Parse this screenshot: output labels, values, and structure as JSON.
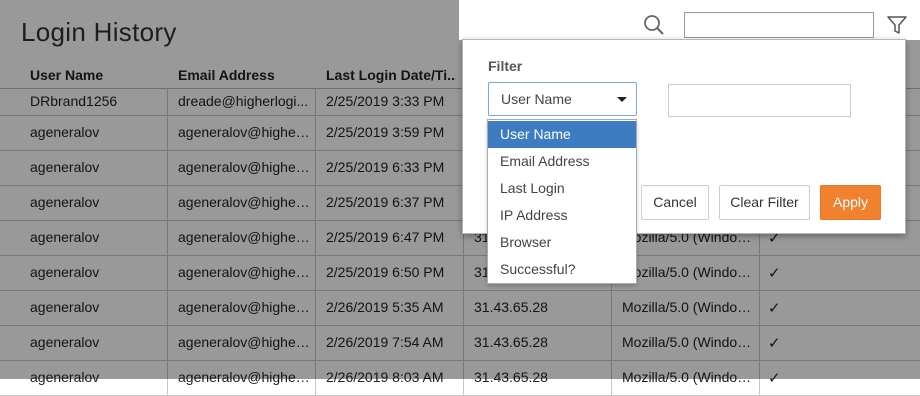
{
  "page": {
    "title": "Login History"
  },
  "table": {
    "headers": [
      "User Name",
      "Email Address",
      "Last Login Date/Ti..."
    ],
    "rows": [
      {
        "user": "DRbrand1256",
        "email": "dreade@higherlogi...",
        "date": "2/25/2019 3:33 PM",
        "ip": "",
        "browser": "",
        "ok": ""
      },
      {
        "user": "ageneralov",
        "email": "ageneralov@higherl...",
        "date": "2/25/2019 3:59 PM",
        "ip": "",
        "browser": "",
        "ok": ""
      },
      {
        "user": "ageneralov",
        "email": "ageneralov@higherl...",
        "date": "2/25/2019 6:33 PM",
        "ip": "",
        "browser": "",
        "ok": ""
      },
      {
        "user": "ageneralov",
        "email": "ageneralov@higherl...",
        "date": "2/25/2019 6:37 PM",
        "ip": "",
        "browser": "",
        "ok": ""
      },
      {
        "user": "ageneralov",
        "email": "ageneralov@higherl...",
        "date": "2/25/2019 6:47 PM",
        "ip": "31.",
        "browser": "Mozilla/5.0 (Window...",
        "ok": "✓"
      },
      {
        "user": "ageneralov",
        "email": "ageneralov@higherl...",
        "date": "2/25/2019 6:50 PM",
        "ip": "31.",
        "browser": "Mozilla/5.0 (Window...",
        "ok": "✓"
      },
      {
        "user": "ageneralov",
        "email": "ageneralov@higherl...",
        "date": "2/26/2019 5:35 AM",
        "ip": "31.43.65.28",
        "browser": "Mozilla/5.0 (Window...",
        "ok": "✓"
      },
      {
        "user": "ageneralov",
        "email": "ageneralov@higherl...",
        "date": "2/26/2019 7:54 AM",
        "ip": "31.43.65.28",
        "browser": "Mozilla/5.0 (Window...",
        "ok": "✓"
      },
      {
        "user": "ageneralov",
        "email": "ageneralov@higherl...",
        "date": "2/26/2019 8:03 AM",
        "ip": "31.43.65.28",
        "browser": "Mozilla/5.0 (Window...",
        "ok": "✓"
      }
    ]
  },
  "toolbar": {
    "search_value": "",
    "search_icon": "search-icon",
    "filter_icon": "filter-icon"
  },
  "filter": {
    "label": "Filter",
    "selected_field": "User Name",
    "value": "",
    "options": [
      "User Name",
      "Email Address",
      "Last Login",
      "IP Address",
      "Browser",
      "Successful?"
    ],
    "cancel_label": "Cancel",
    "clear_label": "Clear Filter",
    "apply_label": "Apply"
  },
  "colors": {
    "accent": "#f0812f",
    "selected_option": "#3d7cc0",
    "overlay": "rgba(0,0,0,0.40)"
  }
}
